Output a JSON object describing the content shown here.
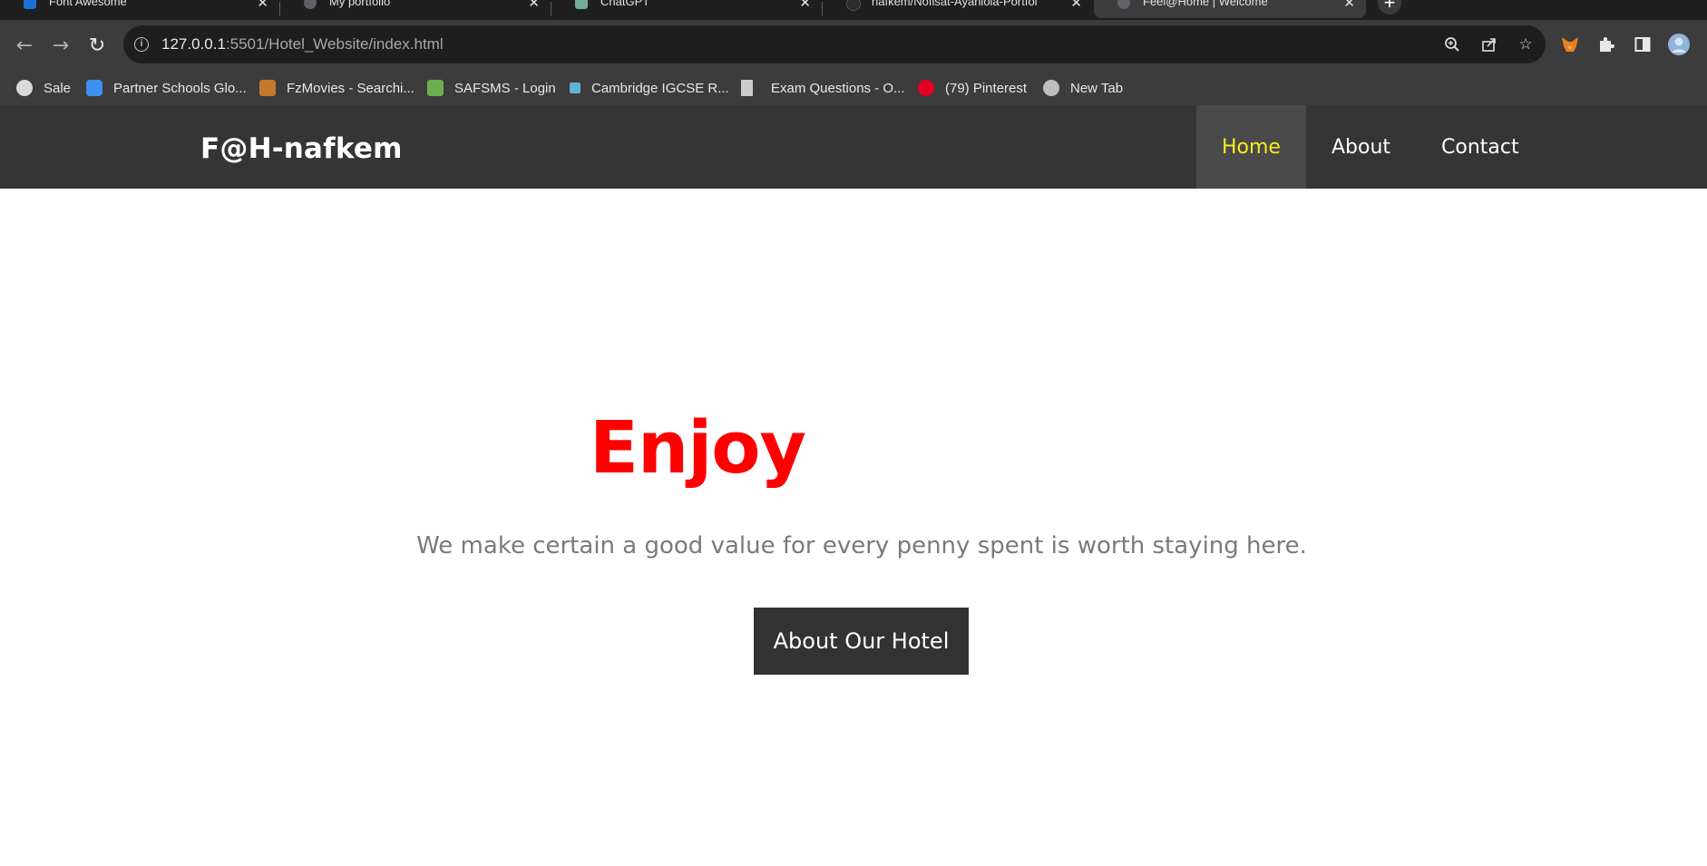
{
  "browser": {
    "tabs": [
      {
        "title": "Font Awesome",
        "active": false
      },
      {
        "title": "My portfolio",
        "active": false
      },
      {
        "title": "ChatGPT",
        "active": false
      },
      {
        "title": "nafkem/Nofisat-Ayanlola-Portfol",
        "active": false
      },
      {
        "title": "Feel@Home | Welcome",
        "active": true
      }
    ],
    "tab_close": "✕",
    "new_tab": "+",
    "address": {
      "host": "127.0.0.1",
      "rest": ":5501/Hotel_Website/index.html"
    },
    "bookmarks": [
      {
        "label": "Sale",
        "icon": "sale-icon",
        "color": "#d9d9d9"
      },
      {
        "label": "Partner Schools Glo...",
        "icon": "partner-schools-icon",
        "color": "#3d8ef0"
      },
      {
        "label": "FzMovies - Searchi...",
        "icon": "fzmovies-icon",
        "color": "#c47a2c"
      },
      {
        "label": "SAFSMS - Login",
        "icon": "safsms-icon",
        "color": "#6ab04c"
      },
      {
        "label": "Cambridge IGCSE R...",
        "icon": "cambridge-icon",
        "color": "#5fb3d9"
      },
      {
        "label": "Exam Questions - O...",
        "icon": "document-icon",
        "color": "#cccccc"
      },
      {
        "label": "(79) Pinterest",
        "icon": "pinterest-icon",
        "color": "#e60023"
      },
      {
        "label": "New Tab",
        "icon": "globe-icon",
        "color": "#bdbdbd"
      }
    ]
  },
  "site": {
    "logo": "F@H-nafkem",
    "nav": [
      {
        "label": "Home",
        "active": true
      },
      {
        "label": "About",
        "active": false
      },
      {
        "label": "Contact",
        "active": false
      }
    ],
    "hero": {
      "title": "Enjoy",
      "subtitle": "We make certain a good value for every penny spent is worth staying here.",
      "button": "About Our Hotel"
    }
  },
  "colors": {
    "header_bg": "#353535",
    "nav_active_text": "#f4ef1f",
    "hero_title": "#ff0000",
    "hero_subtitle": "#7a7a7a",
    "button_bg": "#333333"
  }
}
